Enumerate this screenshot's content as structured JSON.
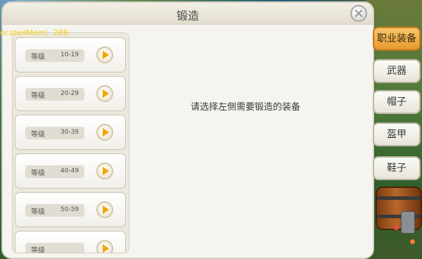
{
  "debug": {
    "text": "ocatedMem：288"
  },
  "dialog": {
    "title": "锻造",
    "hint": "请选择左侧需要锻造的装备"
  },
  "levels": [
    {
      "label": "等级",
      "range": "10-19"
    },
    {
      "label": "等级",
      "range": "20-29"
    },
    {
      "label": "等级",
      "range": "30-39"
    },
    {
      "label": "等级",
      "range": "40-49"
    },
    {
      "label": "等级",
      "range": "50-59"
    },
    {
      "label": "等级",
      "range": ""
    }
  ],
  "tabs": [
    {
      "label": "职业装备",
      "active": true
    },
    {
      "label": "武器",
      "active": false
    },
    {
      "label": "帽子",
      "active": false
    },
    {
      "label": "盔甲",
      "active": false
    },
    {
      "label": "鞋子",
      "active": false
    }
  ],
  "colors": {
    "accent": "#f0a500",
    "active_tab": "#e89a2f",
    "dialog_bg": "#f6f4ee"
  }
}
